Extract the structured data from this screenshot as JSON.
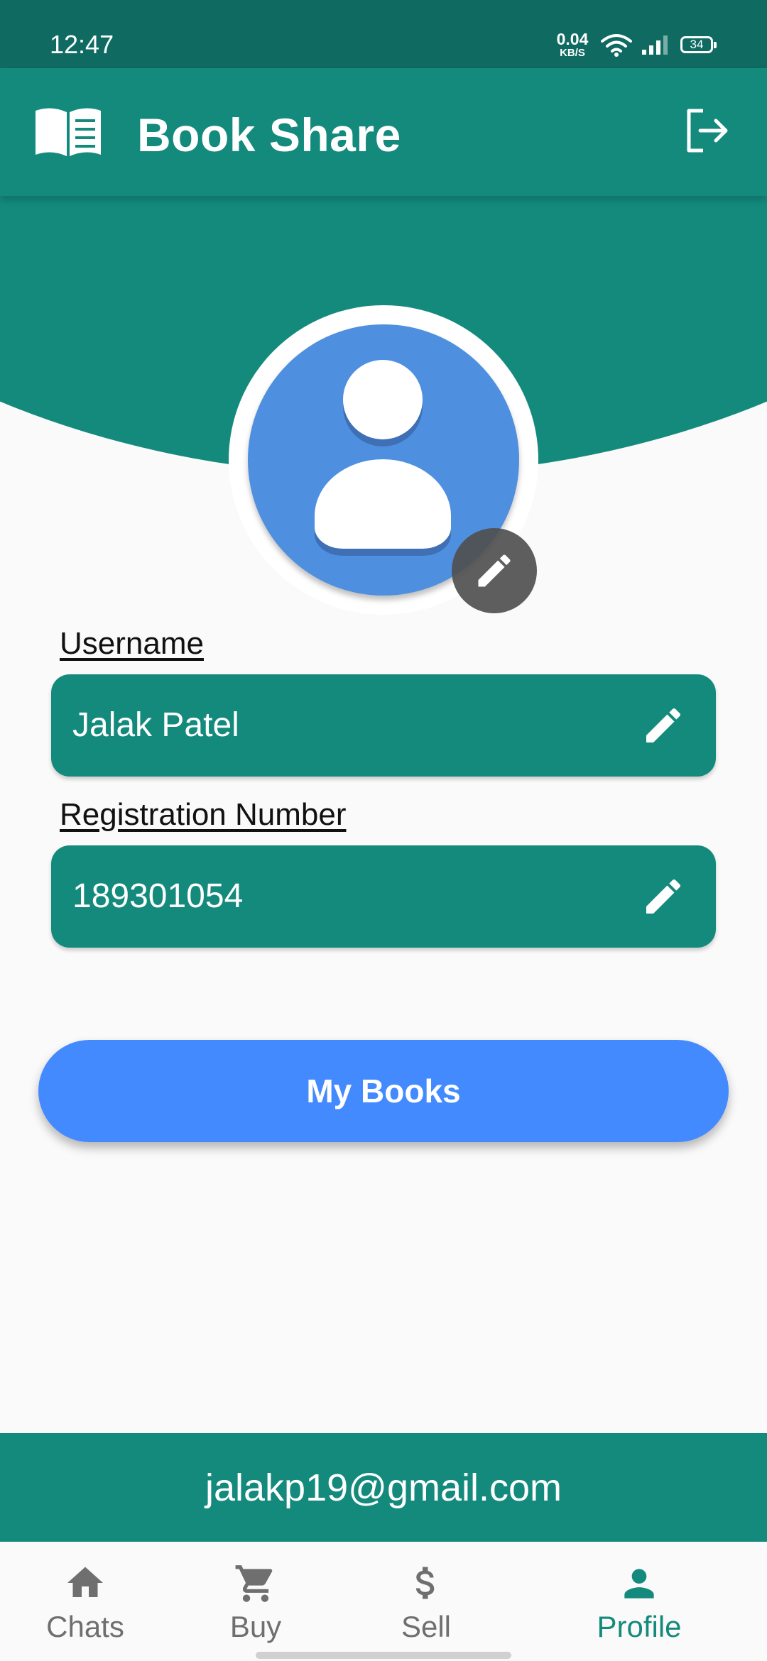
{
  "status_bar": {
    "time": "12:47",
    "net_speed_value": "0.04",
    "net_speed_unit": "KB/S",
    "battery": "34",
    "icons": [
      "wifi-icon",
      "signal-icon",
      "battery-icon"
    ]
  },
  "app_bar": {
    "title": "Book Share",
    "logo_icon": "open-book-icon",
    "action_icon": "logout-icon"
  },
  "profile": {
    "avatar_icon": "person-icon",
    "edit_avatar_icon": "pencil-icon",
    "fields": [
      {
        "label": "Username",
        "value": "Jalak Patel",
        "edit_icon": "pencil-icon"
      },
      {
        "label": "Registration Number",
        "value": "189301054",
        "edit_icon": "pencil-icon"
      }
    ],
    "my_books_label": "My Books",
    "email": "jalakp19@gmail.com"
  },
  "bottom_nav": {
    "items": [
      {
        "label": "Chats",
        "icon": "home-icon",
        "active": false
      },
      {
        "label": "Buy",
        "icon": "cart-icon",
        "active": false
      },
      {
        "label": "Sell",
        "icon": "dollar-icon",
        "active": false
      },
      {
        "label": "Profile",
        "icon": "person-icon",
        "active": true
      }
    ]
  },
  "colors": {
    "primary": "#148a7d",
    "status_bar": "#0f6b62",
    "avatar": "#4f8fe0",
    "button": "#448aff",
    "inactive_nav": "#6f6f6f"
  }
}
